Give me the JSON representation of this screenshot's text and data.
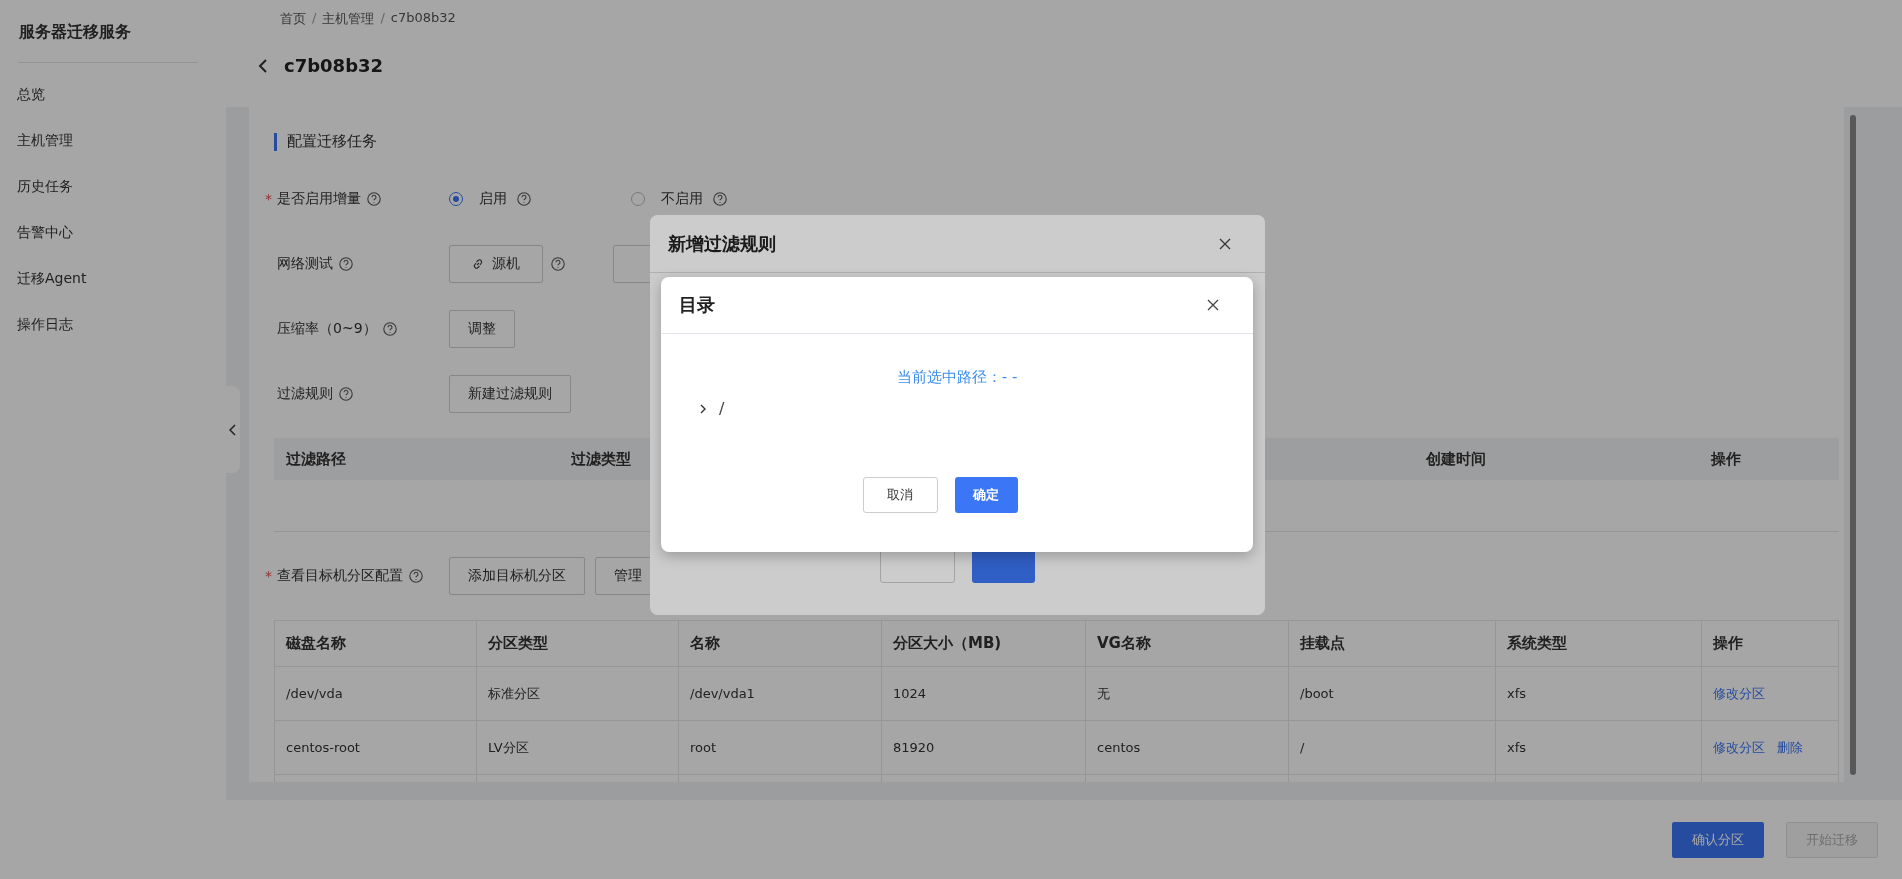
{
  "sidebar": {
    "title": "服务器迁移服务",
    "items": [
      {
        "label": "总览",
        "selected": false
      },
      {
        "label": "主机管理",
        "selected": false
      },
      {
        "label": "历史任务",
        "selected": false
      },
      {
        "label": "告警中心",
        "selected": false
      },
      {
        "label": "迁移Agent",
        "selected": false
      },
      {
        "label": "操作日志",
        "selected": false
      }
    ]
  },
  "breadcrumb": {
    "items": [
      "首页",
      "主机管理",
      "c7b08b32"
    ],
    "separator": "/"
  },
  "page_title": "c7b08b32",
  "form": {
    "section_title": "配置迁移任务",
    "rows": [
      {
        "kind": "radio",
        "label": "是否启用增量",
        "mark": "*",
        "options": [
          {
            "label": "启用",
            "selected": true
          },
          {
            "label": "不启用",
            "selected": false
          }
        ]
      },
      {
        "kind": "network",
        "label": "网络测试",
        "button": "源机"
      },
      {
        "kind": "button",
        "label": "压缩率（0~9）",
        "button": "调整"
      },
      {
        "kind": "button",
        "label": "过滤规则",
        "button": "新建过滤规则"
      }
    ]
  },
  "filter_table": {
    "columns": [
      "过滤路径",
      "过滤类型",
      "创建时间",
      "操作"
    ]
  },
  "partition": {
    "label": "查看目标机分区配置",
    "mark": "*",
    "buttons": [
      "添加目标机分区",
      "管理"
    ]
  },
  "partition_table": {
    "columns": [
      "磁盘名称",
      "分区类型",
      "名称",
      "分区大小（MB)",
      "VG名称",
      "挂载点",
      "系统类型",
      "操作"
    ],
    "rows": [
      {
        "cells": [
          "/dev/vda",
          "标准分区",
          "/dev/vda1",
          "1024",
          "无",
          "/boot",
          "xfs"
        ],
        "actions": [
          "修改分区"
        ]
      },
      {
        "cells": [
          "centos-root",
          "LV分区",
          "root",
          "81920",
          "centos",
          "/",
          "xfs"
        ],
        "actions": [
          "修改分区",
          "删除"
        ]
      }
    ]
  },
  "footer": {
    "buttons": [
      {
        "label": "确认分区",
        "disabled": false
      },
      {
        "label": "开始迁移",
        "disabled": true
      }
    ]
  },
  "outer_modal": {
    "title": "新增过滤规则"
  },
  "inner_modal": {
    "title": "目录",
    "current_path": "当前选中路径：- -",
    "tree": [
      {
        "label": "/",
        "expanded": false
      }
    ],
    "buttons": [
      {
        "label": "取消",
        "kind": "cancel"
      },
      {
        "label": "确定",
        "kind": "primary"
      }
    ]
  }
}
